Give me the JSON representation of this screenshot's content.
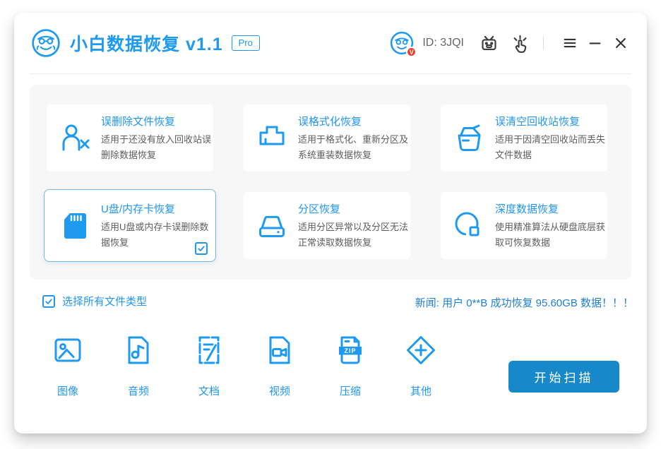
{
  "titlebar": {
    "app_title": "小白数据恢复 v1.1",
    "pro_badge": "Pro",
    "user_id": "ID: 3JQI",
    "vip_badge": "V"
  },
  "modes": [
    {
      "title": "误删除文件恢复",
      "desc": "适用于还没有放入回收站误删除数据恢复",
      "selected": false
    },
    {
      "title": "误格式化恢复",
      "desc": "适用于格式化、重新分区及系统重装数据恢复",
      "selected": false
    },
    {
      "title": "误清空回收站恢复",
      "desc": "适用于因清空回收站而丢失文件数据",
      "selected": false
    },
    {
      "title": "U盘/内存卡恢复",
      "desc": "适用U盘或内存卡误删除数据恢复",
      "selected": true
    },
    {
      "title": "分区恢复",
      "desc": "适用分区异常以及分区无法正常读取数据恢复",
      "selected": false
    },
    {
      "title": "深度数据恢复",
      "desc": "使用精准算法从硬盘底层获取可恢复数据",
      "selected": false
    }
  ],
  "file_section": {
    "select_all_label": "选择所有文件类型",
    "select_all_checked": true,
    "news": "新闻: 用户 0**B 成功恢复 95.60GB 数据！！！",
    "types": [
      {
        "label": "图像"
      },
      {
        "label": "音频"
      },
      {
        "label": "文档"
      },
      {
        "label": "视频"
      },
      {
        "label": "压缩",
        "icon_text": "ZIP"
      },
      {
        "label": "其他"
      }
    ]
  },
  "actions": {
    "scan_button": "开始扫描"
  },
  "colors": {
    "accent": "#1e9af0",
    "card_title": "#2196f3",
    "button": "#1789ca",
    "news_text": "#1e7fd4",
    "vip_red": "#e8402b"
  }
}
